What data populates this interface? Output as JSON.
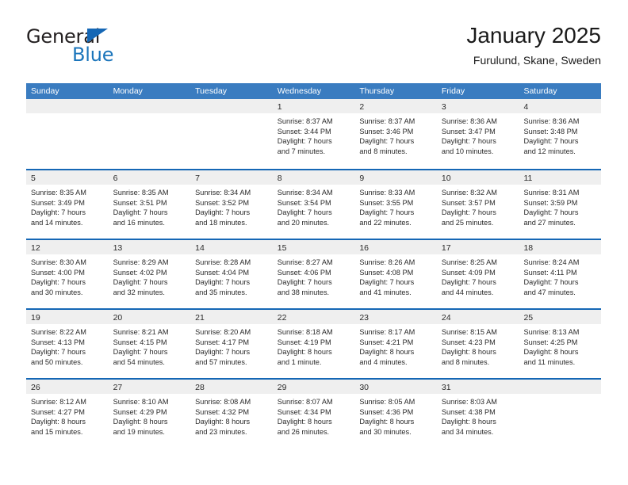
{
  "brand": {
    "name_top": "General",
    "name_bottom": "Blue",
    "color_dark": "#231f20",
    "color_blue": "#1b75bb"
  },
  "header": {
    "title": "January 2025",
    "subtitle": "Furulund, Skane, Sweden"
  },
  "theme": {
    "header_bar": "#3a7cc0",
    "row_divider": "#1567b5",
    "day_strip": "#efefef",
    "text": "#2a2a2a"
  },
  "calendar": {
    "weekday_headers": [
      "Sunday",
      "Monday",
      "Tuesday",
      "Wednesday",
      "Thursday",
      "Friday",
      "Saturday"
    ],
    "weeks": [
      [
        {
          "day": "",
          "sunrise": "",
          "sunset": "",
          "daylight_line1": "",
          "daylight_line2": "",
          "empty": true
        },
        {
          "day": "",
          "sunrise": "",
          "sunset": "",
          "daylight_line1": "",
          "daylight_line2": "",
          "empty": true
        },
        {
          "day": "",
          "sunrise": "",
          "sunset": "",
          "daylight_line1": "",
          "daylight_line2": "",
          "empty": true
        },
        {
          "day": "1",
          "sunrise": "Sunrise: 8:37 AM",
          "sunset": "Sunset: 3:44 PM",
          "daylight_line1": "Daylight: 7 hours",
          "daylight_line2": "and 7 minutes.",
          "empty": false
        },
        {
          "day": "2",
          "sunrise": "Sunrise: 8:37 AM",
          "sunset": "Sunset: 3:46 PM",
          "daylight_line1": "Daylight: 7 hours",
          "daylight_line2": "and 8 minutes.",
          "empty": false
        },
        {
          "day": "3",
          "sunrise": "Sunrise: 8:36 AM",
          "sunset": "Sunset: 3:47 PM",
          "daylight_line1": "Daylight: 7 hours",
          "daylight_line2": "and 10 minutes.",
          "empty": false
        },
        {
          "day": "4",
          "sunrise": "Sunrise: 8:36 AM",
          "sunset": "Sunset: 3:48 PM",
          "daylight_line1": "Daylight: 7 hours",
          "daylight_line2": "and 12 minutes.",
          "empty": false
        }
      ],
      [
        {
          "day": "5",
          "sunrise": "Sunrise: 8:35 AM",
          "sunset": "Sunset: 3:49 PM",
          "daylight_line1": "Daylight: 7 hours",
          "daylight_line2": "and 14 minutes.",
          "empty": false
        },
        {
          "day": "6",
          "sunrise": "Sunrise: 8:35 AM",
          "sunset": "Sunset: 3:51 PM",
          "daylight_line1": "Daylight: 7 hours",
          "daylight_line2": "and 16 minutes.",
          "empty": false
        },
        {
          "day": "7",
          "sunrise": "Sunrise: 8:34 AM",
          "sunset": "Sunset: 3:52 PM",
          "daylight_line1": "Daylight: 7 hours",
          "daylight_line2": "and 18 minutes.",
          "empty": false
        },
        {
          "day": "8",
          "sunrise": "Sunrise: 8:34 AM",
          "sunset": "Sunset: 3:54 PM",
          "daylight_line1": "Daylight: 7 hours",
          "daylight_line2": "and 20 minutes.",
          "empty": false
        },
        {
          "day": "9",
          "sunrise": "Sunrise: 8:33 AM",
          "sunset": "Sunset: 3:55 PM",
          "daylight_line1": "Daylight: 7 hours",
          "daylight_line2": "and 22 minutes.",
          "empty": false
        },
        {
          "day": "10",
          "sunrise": "Sunrise: 8:32 AM",
          "sunset": "Sunset: 3:57 PM",
          "daylight_line1": "Daylight: 7 hours",
          "daylight_line2": "and 25 minutes.",
          "empty": false
        },
        {
          "day": "11",
          "sunrise": "Sunrise: 8:31 AM",
          "sunset": "Sunset: 3:59 PM",
          "daylight_line1": "Daylight: 7 hours",
          "daylight_line2": "and 27 minutes.",
          "empty": false
        }
      ],
      [
        {
          "day": "12",
          "sunrise": "Sunrise: 8:30 AM",
          "sunset": "Sunset: 4:00 PM",
          "daylight_line1": "Daylight: 7 hours",
          "daylight_line2": "and 30 minutes.",
          "empty": false
        },
        {
          "day": "13",
          "sunrise": "Sunrise: 8:29 AM",
          "sunset": "Sunset: 4:02 PM",
          "daylight_line1": "Daylight: 7 hours",
          "daylight_line2": "and 32 minutes.",
          "empty": false
        },
        {
          "day": "14",
          "sunrise": "Sunrise: 8:28 AM",
          "sunset": "Sunset: 4:04 PM",
          "daylight_line1": "Daylight: 7 hours",
          "daylight_line2": "and 35 minutes.",
          "empty": false
        },
        {
          "day": "15",
          "sunrise": "Sunrise: 8:27 AM",
          "sunset": "Sunset: 4:06 PM",
          "daylight_line1": "Daylight: 7 hours",
          "daylight_line2": "and 38 minutes.",
          "empty": false
        },
        {
          "day": "16",
          "sunrise": "Sunrise: 8:26 AM",
          "sunset": "Sunset: 4:08 PM",
          "daylight_line1": "Daylight: 7 hours",
          "daylight_line2": "and 41 minutes.",
          "empty": false
        },
        {
          "day": "17",
          "sunrise": "Sunrise: 8:25 AM",
          "sunset": "Sunset: 4:09 PM",
          "daylight_line1": "Daylight: 7 hours",
          "daylight_line2": "and 44 minutes.",
          "empty": false
        },
        {
          "day": "18",
          "sunrise": "Sunrise: 8:24 AM",
          "sunset": "Sunset: 4:11 PM",
          "daylight_line1": "Daylight: 7 hours",
          "daylight_line2": "and 47 minutes.",
          "empty": false
        }
      ],
      [
        {
          "day": "19",
          "sunrise": "Sunrise: 8:22 AM",
          "sunset": "Sunset: 4:13 PM",
          "daylight_line1": "Daylight: 7 hours",
          "daylight_line2": "and 50 minutes.",
          "empty": false
        },
        {
          "day": "20",
          "sunrise": "Sunrise: 8:21 AM",
          "sunset": "Sunset: 4:15 PM",
          "daylight_line1": "Daylight: 7 hours",
          "daylight_line2": "and 54 minutes.",
          "empty": false
        },
        {
          "day": "21",
          "sunrise": "Sunrise: 8:20 AM",
          "sunset": "Sunset: 4:17 PM",
          "daylight_line1": "Daylight: 7 hours",
          "daylight_line2": "and 57 minutes.",
          "empty": false
        },
        {
          "day": "22",
          "sunrise": "Sunrise: 8:18 AM",
          "sunset": "Sunset: 4:19 PM",
          "daylight_line1": "Daylight: 8 hours",
          "daylight_line2": "and 1 minute.",
          "empty": false
        },
        {
          "day": "23",
          "sunrise": "Sunrise: 8:17 AM",
          "sunset": "Sunset: 4:21 PM",
          "daylight_line1": "Daylight: 8 hours",
          "daylight_line2": "and 4 minutes.",
          "empty": false
        },
        {
          "day": "24",
          "sunrise": "Sunrise: 8:15 AM",
          "sunset": "Sunset: 4:23 PM",
          "daylight_line1": "Daylight: 8 hours",
          "daylight_line2": "and 8 minutes.",
          "empty": false
        },
        {
          "day": "25",
          "sunrise": "Sunrise: 8:13 AM",
          "sunset": "Sunset: 4:25 PM",
          "daylight_line1": "Daylight: 8 hours",
          "daylight_line2": "and 11 minutes.",
          "empty": false
        }
      ],
      [
        {
          "day": "26",
          "sunrise": "Sunrise: 8:12 AM",
          "sunset": "Sunset: 4:27 PM",
          "daylight_line1": "Daylight: 8 hours",
          "daylight_line2": "and 15 minutes.",
          "empty": false
        },
        {
          "day": "27",
          "sunrise": "Sunrise: 8:10 AM",
          "sunset": "Sunset: 4:29 PM",
          "daylight_line1": "Daylight: 8 hours",
          "daylight_line2": "and 19 minutes.",
          "empty": false
        },
        {
          "day": "28",
          "sunrise": "Sunrise: 8:08 AM",
          "sunset": "Sunset: 4:32 PM",
          "daylight_line1": "Daylight: 8 hours",
          "daylight_line2": "and 23 minutes.",
          "empty": false
        },
        {
          "day": "29",
          "sunrise": "Sunrise: 8:07 AM",
          "sunset": "Sunset: 4:34 PM",
          "daylight_line1": "Daylight: 8 hours",
          "daylight_line2": "and 26 minutes.",
          "empty": false
        },
        {
          "day": "30",
          "sunrise": "Sunrise: 8:05 AM",
          "sunset": "Sunset: 4:36 PM",
          "daylight_line1": "Daylight: 8 hours",
          "daylight_line2": "and 30 minutes.",
          "empty": false
        },
        {
          "day": "31",
          "sunrise": "Sunrise: 8:03 AM",
          "sunset": "Sunset: 4:38 PM",
          "daylight_line1": "Daylight: 8 hours",
          "daylight_line2": "and 34 minutes.",
          "empty": false
        },
        {
          "day": "",
          "sunrise": "",
          "sunset": "",
          "daylight_line1": "",
          "daylight_line2": "",
          "empty": true
        }
      ]
    ]
  }
}
